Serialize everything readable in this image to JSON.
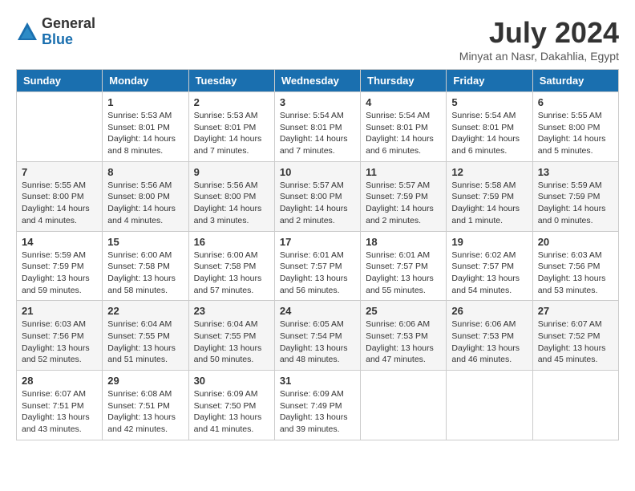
{
  "logo": {
    "general": "General",
    "blue": "Blue"
  },
  "title": "July 2024",
  "location": "Minyat an Nasr, Dakahlia, Egypt",
  "days_of_week": [
    "Sunday",
    "Monday",
    "Tuesday",
    "Wednesday",
    "Thursday",
    "Friday",
    "Saturday"
  ],
  "weeks": [
    [
      {
        "day": "",
        "info": ""
      },
      {
        "day": "1",
        "info": "Sunrise: 5:53 AM\nSunset: 8:01 PM\nDaylight: 14 hours\nand 8 minutes."
      },
      {
        "day": "2",
        "info": "Sunrise: 5:53 AM\nSunset: 8:01 PM\nDaylight: 14 hours\nand 7 minutes."
      },
      {
        "day": "3",
        "info": "Sunrise: 5:54 AM\nSunset: 8:01 PM\nDaylight: 14 hours\nand 7 minutes."
      },
      {
        "day": "4",
        "info": "Sunrise: 5:54 AM\nSunset: 8:01 PM\nDaylight: 14 hours\nand 6 minutes."
      },
      {
        "day": "5",
        "info": "Sunrise: 5:54 AM\nSunset: 8:01 PM\nDaylight: 14 hours\nand 6 minutes."
      },
      {
        "day": "6",
        "info": "Sunrise: 5:55 AM\nSunset: 8:00 PM\nDaylight: 14 hours\nand 5 minutes."
      }
    ],
    [
      {
        "day": "7",
        "info": "Sunrise: 5:55 AM\nSunset: 8:00 PM\nDaylight: 14 hours\nand 4 minutes."
      },
      {
        "day": "8",
        "info": "Sunrise: 5:56 AM\nSunset: 8:00 PM\nDaylight: 14 hours\nand 4 minutes."
      },
      {
        "day": "9",
        "info": "Sunrise: 5:56 AM\nSunset: 8:00 PM\nDaylight: 14 hours\nand 3 minutes."
      },
      {
        "day": "10",
        "info": "Sunrise: 5:57 AM\nSunset: 8:00 PM\nDaylight: 14 hours\nand 2 minutes."
      },
      {
        "day": "11",
        "info": "Sunrise: 5:57 AM\nSunset: 7:59 PM\nDaylight: 14 hours\nand 2 minutes."
      },
      {
        "day": "12",
        "info": "Sunrise: 5:58 AM\nSunset: 7:59 PM\nDaylight: 14 hours\nand 1 minute."
      },
      {
        "day": "13",
        "info": "Sunrise: 5:59 AM\nSunset: 7:59 PM\nDaylight: 14 hours\nand 0 minutes."
      }
    ],
    [
      {
        "day": "14",
        "info": "Sunrise: 5:59 AM\nSunset: 7:59 PM\nDaylight: 13 hours\nand 59 minutes."
      },
      {
        "day": "15",
        "info": "Sunrise: 6:00 AM\nSunset: 7:58 PM\nDaylight: 13 hours\nand 58 minutes."
      },
      {
        "day": "16",
        "info": "Sunrise: 6:00 AM\nSunset: 7:58 PM\nDaylight: 13 hours\nand 57 minutes."
      },
      {
        "day": "17",
        "info": "Sunrise: 6:01 AM\nSunset: 7:57 PM\nDaylight: 13 hours\nand 56 minutes."
      },
      {
        "day": "18",
        "info": "Sunrise: 6:01 AM\nSunset: 7:57 PM\nDaylight: 13 hours\nand 55 minutes."
      },
      {
        "day": "19",
        "info": "Sunrise: 6:02 AM\nSunset: 7:57 PM\nDaylight: 13 hours\nand 54 minutes."
      },
      {
        "day": "20",
        "info": "Sunrise: 6:03 AM\nSunset: 7:56 PM\nDaylight: 13 hours\nand 53 minutes."
      }
    ],
    [
      {
        "day": "21",
        "info": "Sunrise: 6:03 AM\nSunset: 7:56 PM\nDaylight: 13 hours\nand 52 minutes."
      },
      {
        "day": "22",
        "info": "Sunrise: 6:04 AM\nSunset: 7:55 PM\nDaylight: 13 hours\nand 51 minutes."
      },
      {
        "day": "23",
        "info": "Sunrise: 6:04 AM\nSunset: 7:55 PM\nDaylight: 13 hours\nand 50 minutes."
      },
      {
        "day": "24",
        "info": "Sunrise: 6:05 AM\nSunset: 7:54 PM\nDaylight: 13 hours\nand 48 minutes."
      },
      {
        "day": "25",
        "info": "Sunrise: 6:06 AM\nSunset: 7:53 PM\nDaylight: 13 hours\nand 47 minutes."
      },
      {
        "day": "26",
        "info": "Sunrise: 6:06 AM\nSunset: 7:53 PM\nDaylight: 13 hours\nand 46 minutes."
      },
      {
        "day": "27",
        "info": "Sunrise: 6:07 AM\nSunset: 7:52 PM\nDaylight: 13 hours\nand 45 minutes."
      }
    ],
    [
      {
        "day": "28",
        "info": "Sunrise: 6:07 AM\nSunset: 7:51 PM\nDaylight: 13 hours\nand 43 minutes."
      },
      {
        "day": "29",
        "info": "Sunrise: 6:08 AM\nSunset: 7:51 PM\nDaylight: 13 hours\nand 42 minutes."
      },
      {
        "day": "30",
        "info": "Sunrise: 6:09 AM\nSunset: 7:50 PM\nDaylight: 13 hours\nand 41 minutes."
      },
      {
        "day": "31",
        "info": "Sunrise: 6:09 AM\nSunset: 7:49 PM\nDaylight: 13 hours\nand 39 minutes."
      },
      {
        "day": "",
        "info": ""
      },
      {
        "day": "",
        "info": ""
      },
      {
        "day": "",
        "info": ""
      }
    ]
  ]
}
